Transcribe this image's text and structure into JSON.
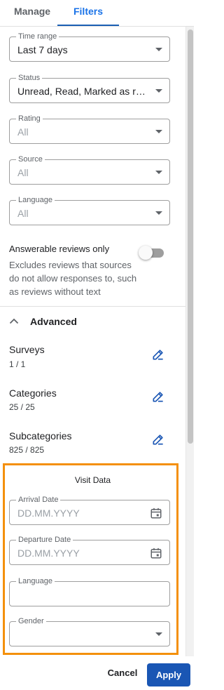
{
  "tabs": {
    "manage": "Manage",
    "filters": "Filters"
  },
  "filters": {
    "time_range": {
      "label": "Time range",
      "value": "Last 7 days"
    },
    "status": {
      "label": "Status",
      "value": "Unread, Read, Marked as responded"
    },
    "rating": {
      "label": "Rating",
      "value": "All"
    },
    "source": {
      "label": "Source",
      "value": "All"
    },
    "language": {
      "label": "Language",
      "value": "All"
    }
  },
  "answerable": {
    "title": "Answerable reviews only",
    "description": "Excludes reviews that sources do not allow responses to, such as reviews without text",
    "enabled": false
  },
  "advanced": {
    "label": "Advanced",
    "surveys": {
      "title": "Surveys",
      "count": "1 / 1"
    },
    "categories": {
      "title": "Categories",
      "count": "25 / 25"
    },
    "subcategories": {
      "title": "Subcategories",
      "count": "825 / 825"
    }
  },
  "visit_data": {
    "title": "Visit Data",
    "arrival": {
      "label": "Arrival Date",
      "placeholder": "DD.MM.YYYY"
    },
    "departure": {
      "label": "Departure Date",
      "placeholder": "DD.MM.YYYY"
    },
    "language": {
      "label": "Language",
      "value": ""
    },
    "gender": {
      "label": "Gender",
      "value": ""
    }
  },
  "footer": {
    "cancel": "Cancel",
    "apply": "Apply"
  },
  "colors": {
    "accent": "#1a56b4",
    "highlight": "#f4900c"
  },
  "icons": {
    "dropdown": "chevron-down-icon",
    "calendar": "calendar-icon",
    "edit": "edit-icon",
    "collapse": "chevron-up-icon"
  }
}
